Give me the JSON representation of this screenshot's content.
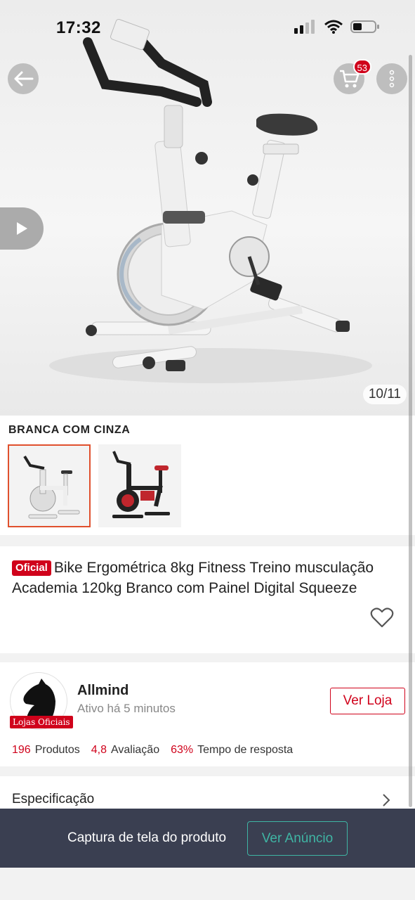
{
  "status_bar": {
    "time": "17:32"
  },
  "header": {
    "cart_count": "53"
  },
  "gallery": {
    "counter": "10/11"
  },
  "variation": {
    "title": "BRANCA COM CINZA"
  },
  "product": {
    "tag": "Oficial",
    "title": "Bike Ergométrica 8kg Fitness Treino musculação Academia 120kg Branco com Painel Digital Squeeze"
  },
  "store": {
    "name": "Allmind",
    "status": "Ativo há 5 minutos",
    "official_tag": "Lojas Oficiais",
    "ver_loja_label": "Ver Loja",
    "stats": [
      {
        "value": "196",
        "label": "Produtos"
      },
      {
        "value": "4,8",
        "label": "Avaliação"
      },
      {
        "value": "63%",
        "label": "Tempo de resposta"
      }
    ]
  },
  "spec": {
    "label": "Especificação"
  },
  "bottom_bar": {
    "text": "Captura de tela do produto",
    "button_label": "Ver Anúncio"
  },
  "colors": {
    "accent": "#d0021b",
    "bar_bg": "#3a3f51",
    "teal": "#3fb5a4"
  }
}
